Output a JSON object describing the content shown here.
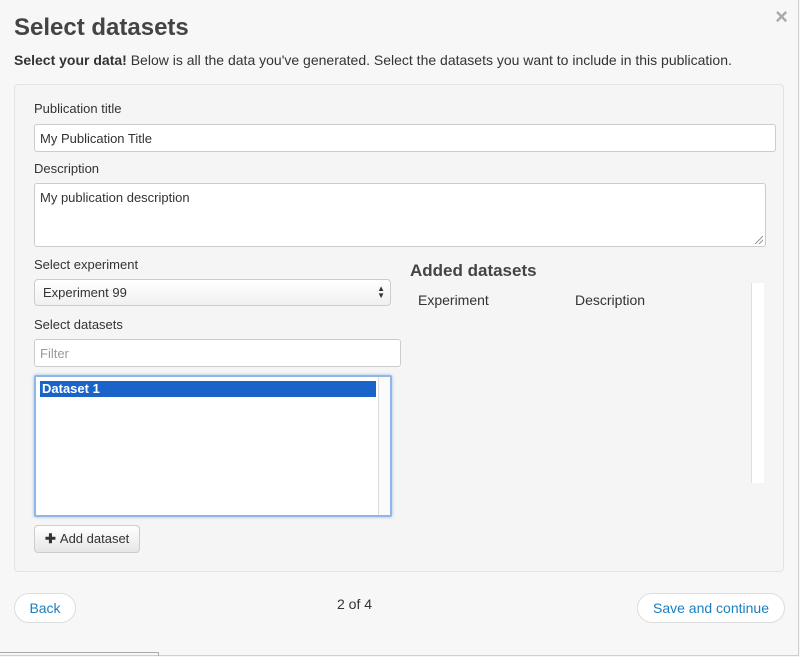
{
  "modal": {
    "title": "Select datasets",
    "lead_bold": "Select your data!",
    "lead_rest": " Below is all the data you've generated. Select the datasets you want to include in this publication.",
    "close_icon": "×"
  },
  "form": {
    "publication_title_label": "Publication title",
    "publication_title_value": "My Publication Title",
    "description_label": "Description",
    "description_value": "My publication description",
    "experiment_label": "Select experiment",
    "experiment_selected": "Experiment 99",
    "datasets_label": "Select datasets",
    "filter_placeholder": "Filter",
    "datasets_options": [
      "Dataset 1"
    ],
    "add_dataset_label": "Add dataset"
  },
  "added": {
    "title": "Added datasets",
    "columns": [
      "Experiment",
      "Description"
    ]
  },
  "footer": {
    "back_label": "Back",
    "pager": "2 of 4",
    "save_label": "Save and continue"
  },
  "colors": {
    "accent": "#1a7fc0",
    "selection": "#1a63c9"
  }
}
